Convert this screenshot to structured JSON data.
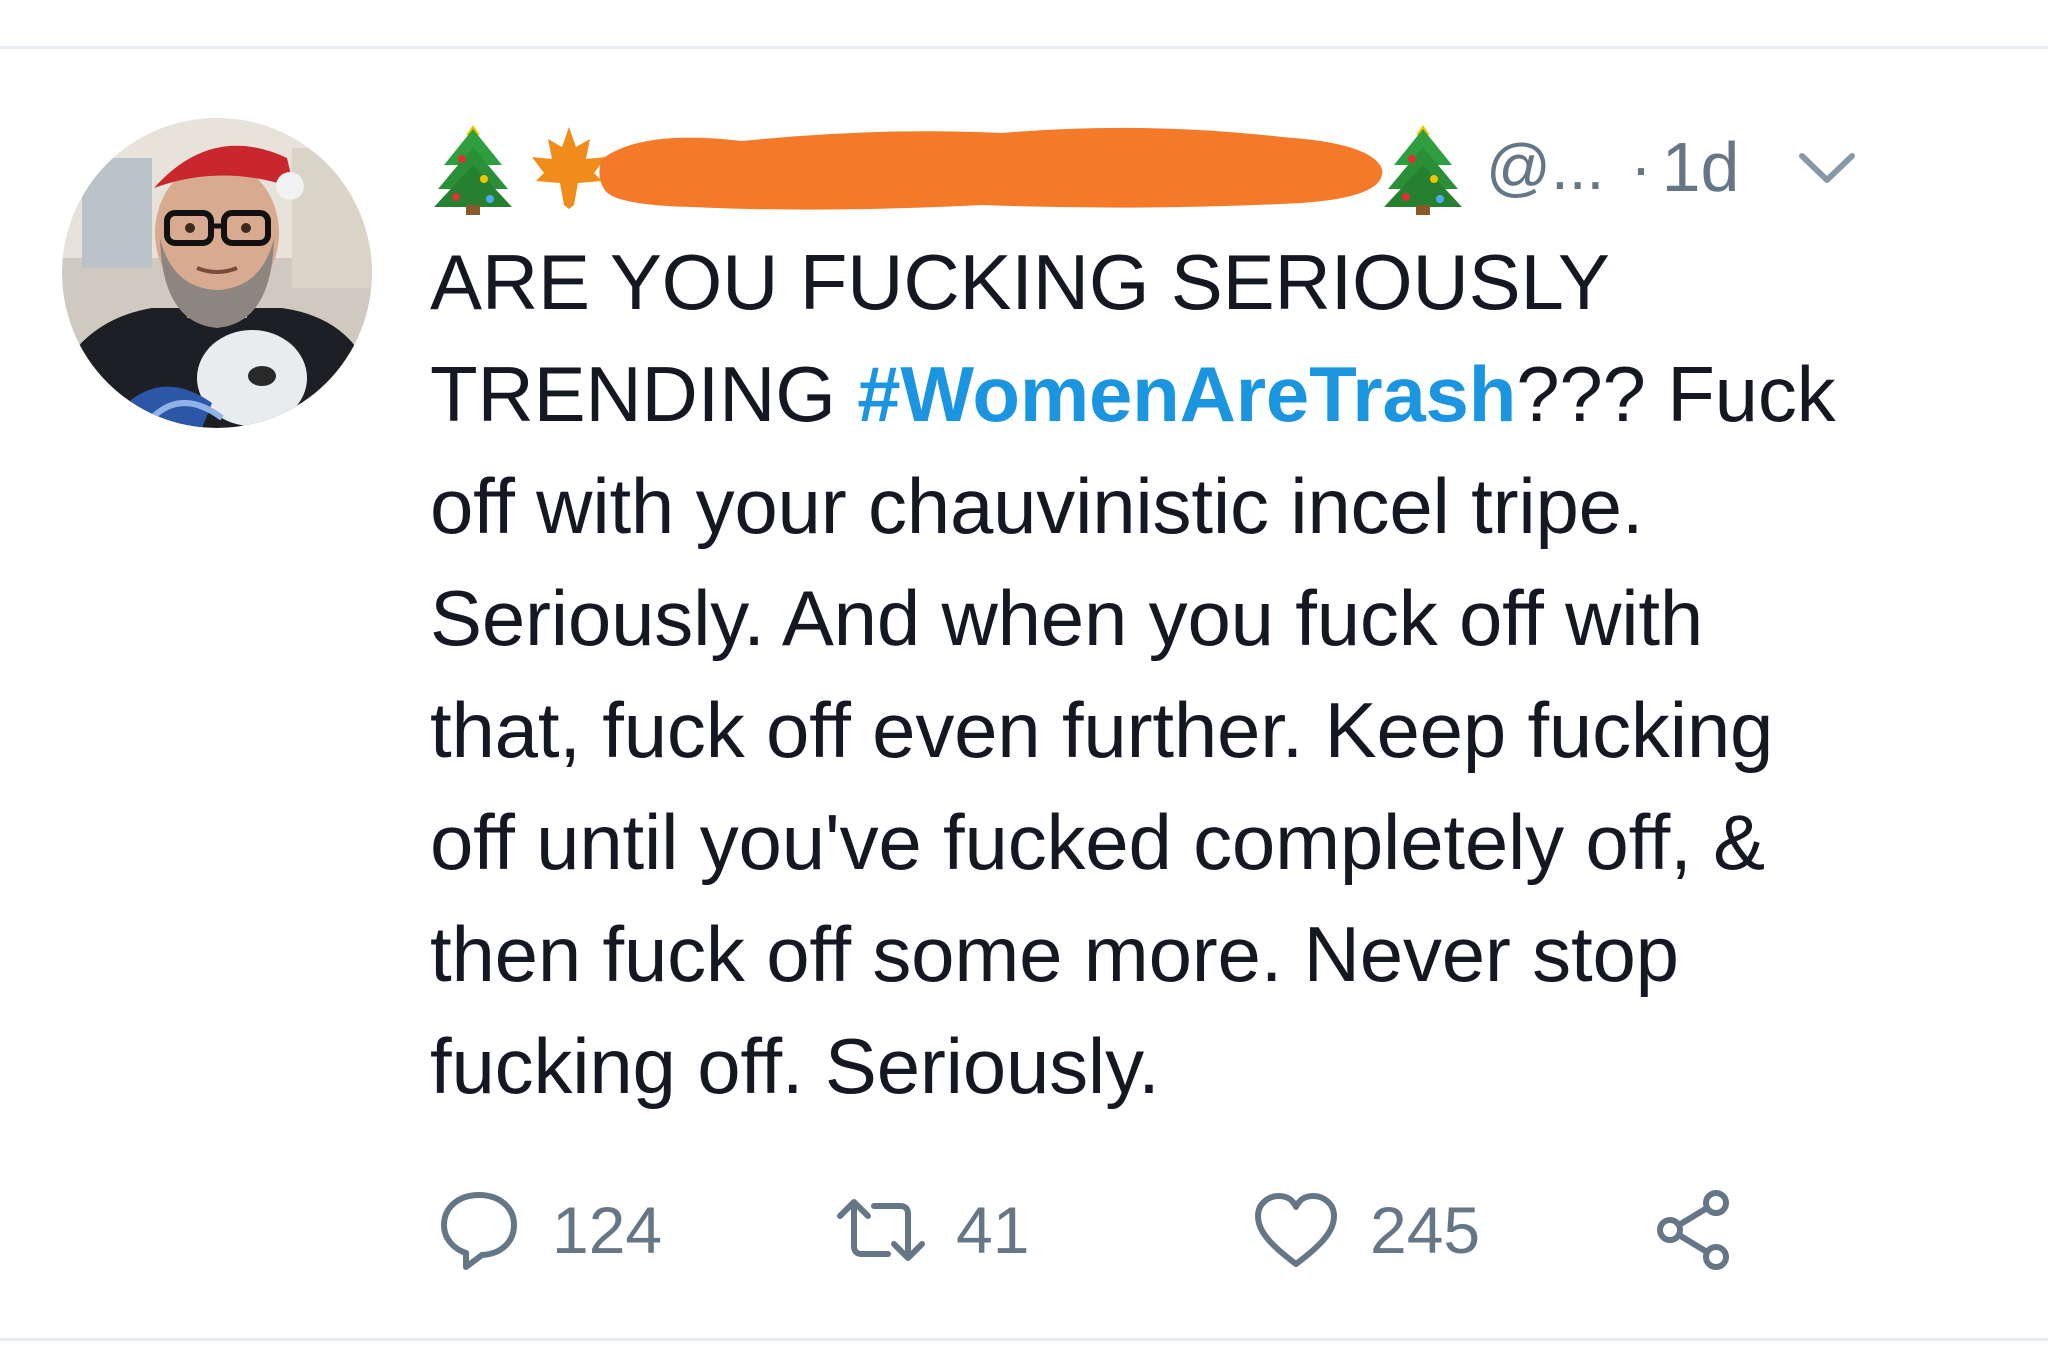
{
  "tweet": {
    "handle": "@...",
    "dot": "·",
    "time": "1d",
    "text_lines": [
      {
        "before": "ARE YOU FUCKING SERIOUSLY",
        "hashtag": "",
        "after": ""
      },
      {
        "before": "TRENDING ",
        "hashtag": "#WomenAreTrash",
        "after": "??? Fuck"
      },
      {
        "before": "off with your chauvinistic incel tripe.",
        "hashtag": "",
        "after": ""
      },
      {
        "before": "Seriously. And when you fuck off with",
        "hashtag": "",
        "after": ""
      },
      {
        "before": "that, fuck off even further. Keep fucking",
        "hashtag": "",
        "after": ""
      },
      {
        "before": "off until you've fucked completely off, &",
        "hashtag": "",
        "after": ""
      },
      {
        "before": "then fuck off some more. Never stop",
        "hashtag": "",
        "after": ""
      },
      {
        "before": "fucking off. Seriously.",
        "hashtag": "",
        "after": ""
      }
    ],
    "actions": {
      "reply_count": "124",
      "retweet_count": "41",
      "like_count": "245"
    }
  },
  "colors": {
    "hashtag": "#1b95e0",
    "meta": "#657786",
    "text": "#141823",
    "redaction": "#f47a2a"
  },
  "icons": {
    "reply": "speech-bubble-icon",
    "retweet": "retweet-arrows-icon",
    "like": "heart-outline-icon",
    "share": "share-nodes-icon",
    "menu": "chevron-down-icon"
  }
}
